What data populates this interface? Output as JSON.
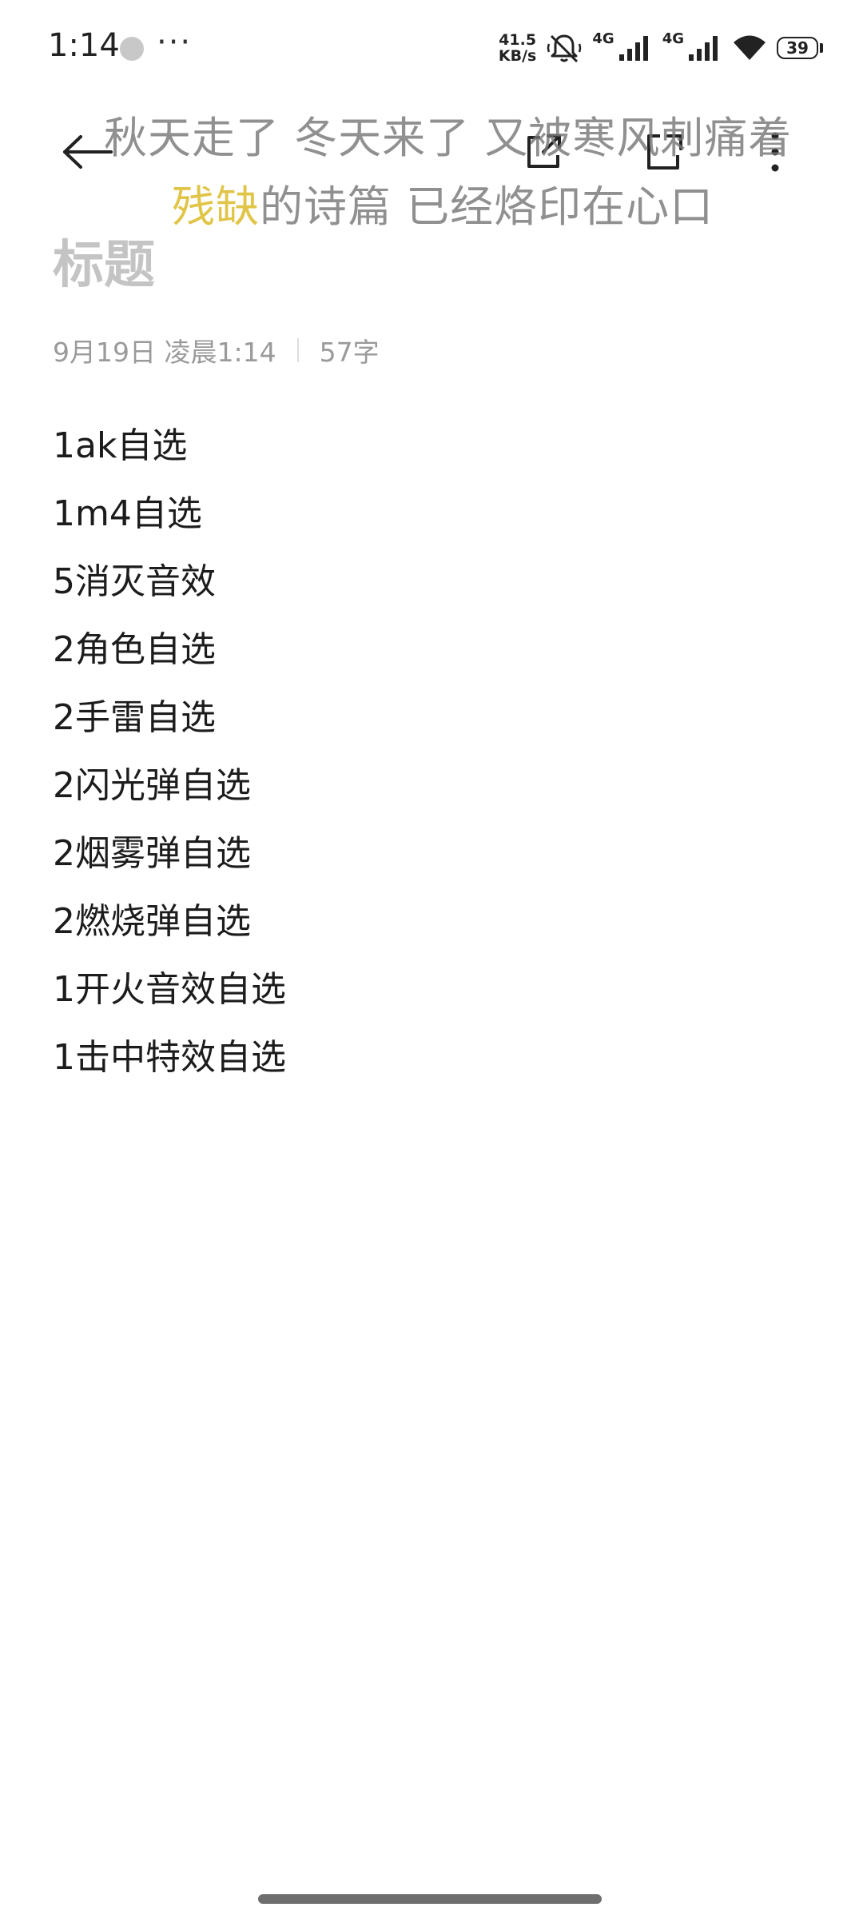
{
  "status_bar": {
    "time": "1:14",
    "more": "···",
    "net_speed_value": "41.5",
    "net_speed_unit": "KB/s",
    "sim1_label": "4G",
    "sim2_label": "4G",
    "battery_level": "39"
  },
  "lyrics": {
    "line1": "秋天走了 冬天来了 又被寒风刺痛着",
    "line2_highlight": "残缺",
    "line2_rest": "的诗篇 已经烙印在心口"
  },
  "note": {
    "title_placeholder": "标题",
    "date": "9月19日 凌晨1:14",
    "word_count": "57字",
    "lines": [
      "1ak自选",
      "1m4自选",
      "5消灭音效",
      "2角色自选",
      "2手雷自选",
      "2闪光弹自选",
      "2烟雾弹自选",
      "2燃烧弹自选",
      "1开火音效自选",
      "1击中特效自选"
    ]
  },
  "icons": {
    "back": "arrow-left-icon",
    "share": "share-icon",
    "fullscreen": "fullscreen-icon",
    "more": "more-vertical-icon"
  }
}
